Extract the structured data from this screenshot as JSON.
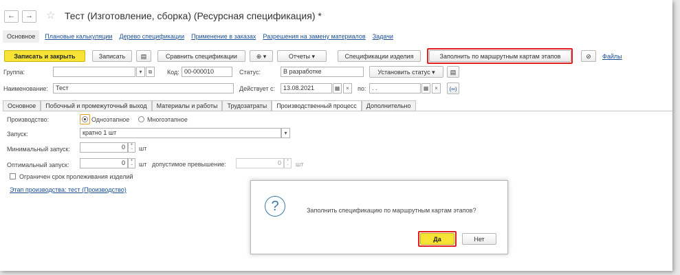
{
  "window": {
    "title": "Тест  (Изготовление, сборка) (Ресурсная спецификация) *",
    "back": "←",
    "forward": "→",
    "star": "☆"
  },
  "nav": {
    "items": [
      "Основное",
      "Плановые калькуляции",
      "Дерево спецификации",
      "Применение в заказах",
      "Разрешения на замену материалов",
      "Задачи"
    ]
  },
  "toolbar": {
    "save_close": "Записать и закрыть",
    "save": "Записать",
    "doc_icon": "▤",
    "compare": "Сравнить спецификации",
    "add_icon": "⊕ ▾",
    "reports": "Отчеты",
    "item_specs": "Спецификации изделия",
    "fill_routes": "Заполнить по маршрутным картам этапов",
    "clip_icon": "⊘",
    "files": "Файлы"
  },
  "form": {
    "group_label": "Группа:",
    "group_value": "",
    "code_label": "Код:",
    "code_value": "00-000010",
    "status_label": "Статус:",
    "status_value": "В разработке",
    "set_status": "Установить статус",
    "name_label": "Наименование:",
    "name_value": "Тест",
    "valid_from_label": "Действует с:",
    "valid_from_value": "13.08.2021",
    "valid_to_label": "по:",
    "valid_to_value": "  .  .",
    "dropdown_glyph": "▾",
    "calendar_glyph": "▦",
    "clear_glyph": "×",
    "copy_glyph": "⧉",
    "link_glyph": "(∞)"
  },
  "tabs": [
    "Основное",
    "Побочный и промежуточный выход",
    "Материалы и работы",
    "Трудозатраты",
    "Производственный процесс",
    "Дополнительно"
  ],
  "production": {
    "production_label": "Производство:",
    "single_stage": "Одноэтапное",
    "multi_stage": "Многоэтапное",
    "launch_label": "Запуск:",
    "launch_value": "кратно 1 шт",
    "min_launch_label": "Минимальный запуск:",
    "min_launch_value": "0",
    "unit": "шт",
    "opt_launch_label": "Оптимальный запуск:",
    "opt_launch_value": "0",
    "allowed_excess_label": "допустимое превышение:",
    "allowed_excess_value": "0",
    "shelf_limit_label": "Ограничен срок пролеживания изделий",
    "stage_link": "Этап производства: тест (Производство)"
  },
  "dialog": {
    "icon": "?",
    "message": "Заполнить спецификацию по маршрутным картам этапов?",
    "yes": "Да",
    "no": "Нет"
  }
}
